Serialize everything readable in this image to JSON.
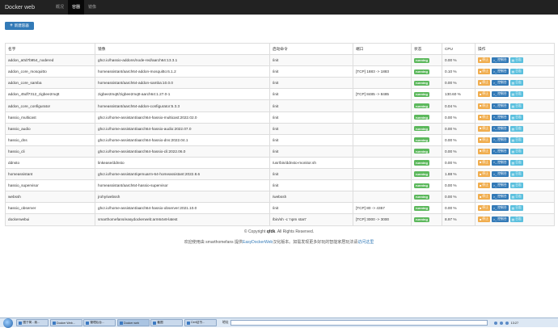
{
  "navbar": {
    "brand": "Docker web",
    "items": [
      {
        "label": "概况",
        "active": false
      },
      {
        "label": "容器",
        "active": true
      },
      {
        "label": "镜像",
        "active": false
      }
    ]
  },
  "toolbar": {
    "create_label": "新建容器"
  },
  "table": {
    "headers": [
      "名字",
      "镜像",
      "启动命令",
      "端口",
      "状态",
      "CPU",
      "操作"
    ],
    "actions": {
      "stop": "停止",
      "console": "控制台",
      "log": "日志"
    },
    "rows": [
      {
        "name": "addon_a0d7b954_nodered",
        "image": "ghcr.io/hassio-addons/node-red/aarch64:13.3.1",
        "command": "/init",
        "ports": "",
        "status": "running",
        "cpu": "0.00 %"
      },
      {
        "name": "addon_core_mosquitto",
        "image": "homeassistant/aarch64-addon-mosquitto:6.1.2",
        "command": "/init",
        "ports": "[TCP] 1883 -> 1883",
        "status": "running",
        "cpu": "0.10 %"
      },
      {
        "name": "addon_core_samba",
        "image": "homeassistant/aarch64-addon-samba:10.0.0",
        "command": "/init",
        "ports": "",
        "status": "running",
        "cpu": "0.00 %"
      },
      {
        "name": "addon_45df7312_zigbee2mqtt",
        "image": "zigbee2mqtt/zigbee2mqtt-aarch64:1.27.0-1",
        "command": "/init",
        "ports": "[TCP] 8485 -> 8485",
        "status": "running",
        "cpu": "130.60 %"
      },
      {
        "name": "addon_core_configurator",
        "image": "homeassistant/aarch64-addon-configurator:5.3.3",
        "command": "/init",
        "ports": "",
        "status": "running",
        "cpu": "0.04 %"
      },
      {
        "name": "hassio_multicast",
        "image": "ghcr.io/home-assistant/aarch64-hassio-multicast:2022.02.0",
        "command": "/init",
        "ports": "",
        "status": "running",
        "cpu": "0.00 %"
      },
      {
        "name": "hassio_audio",
        "image": "ghcr.io/home-assistant/aarch64-hassio-audio:2022.07.0",
        "command": "/init",
        "ports": "",
        "status": "running",
        "cpu": "0.00 %"
      },
      {
        "name": "hassio_dns",
        "image": "ghcr.io/home-assistant/aarch64-hassio-dns:2022.04.1",
        "command": "/init",
        "ports": "",
        "status": "running",
        "cpu": "0.00 %"
      },
      {
        "name": "hassio_cli",
        "image": "ghcr.io/home-assistant/aarch64-hassio-cli:2022.06.0",
        "command": "/init",
        "ports": "",
        "status": "running",
        "cpu": "0.00 %"
      },
      {
        "name": "ddnsto",
        "image": "linkease/ddnsto",
        "command": "/usr/bin/ddnsto-monitor.sh",
        "ports": "",
        "status": "running",
        "cpu": "0.00 %"
      },
      {
        "name": "homeassistant",
        "image": "ghcr.io/home-assistant/qemuarm-64-homeassistant:2022.8.6",
        "command": "/init",
        "ports": "",
        "status": "running",
        "cpu": "1.88 %"
      },
      {
        "name": "hassio_supervisor",
        "image": "homeassistant/aarch64-hassio-supervisor",
        "command": "/init",
        "ports": "",
        "status": "running",
        "cpu": "0.00 %"
      },
      {
        "name": "webssh",
        "image": "jrohy/webssh",
        "command": "/webssh",
        "ports": "",
        "status": "running",
        "cpu": "0.00 %"
      },
      {
        "name": "hassio_observer",
        "image": "ghcr.io/home-assistant/aarch64-hassio-observer:2021.10.0",
        "command": "/init",
        "ports": "[TCP] 80 -> 4357",
        "status": "running",
        "cpu": "0.00 %"
      },
      {
        "name": "dockerwebui",
        "image": "smarthomefans/easydockerweb:arm64v8-latest",
        "command": "/bin/sh -c 'npm start'",
        "ports": "[TCP] 3000 -> 3000",
        "status": "running",
        "cpu": "8.97 %"
      }
    ]
  },
  "footer": {
    "copyright_prefix": "© Copyright",
    "copyright_owner": "qfdk",
    "copyright_suffix": ". All Rights Reserved.",
    "note_prefix": "欢迎使用由 smarthomefans 提供",
    "note_link": "EasyDockerWeb",
    "note_middle": "汉化版本。如需发现更多好玩的智能家居玩法请",
    "note_link2": "访问这里"
  },
  "taskbar": {
    "tasks": [
      {
        "label": "图于简 - 我...",
        "active": false
      },
      {
        "label": "Docker Web...",
        "active": false
      },
      {
        "label": "管理后台...",
        "active": false
      },
      {
        "label": "Docker web",
        "active": true
      },
      {
        "label": "截图",
        "active": false
      },
      {
        "label": "Cert证书...",
        "active": false
      }
    ],
    "address_label": "地址",
    "clock": "13:27"
  },
  "colors": {
    "navbar": "#222222",
    "primary": "#337ab7",
    "running": "#5cb85c",
    "stop": "#f0ad4e",
    "log": "#5bc0de"
  }
}
